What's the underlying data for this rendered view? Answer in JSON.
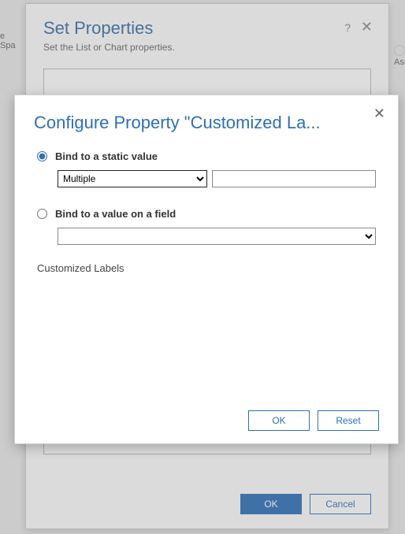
{
  "bg": {
    "left_label": "e Spa",
    "right_label": "Assi"
  },
  "outer": {
    "title": "Set Properties",
    "subtitle": "Set the List or Chart properties.",
    "help": "?",
    "close": "✕",
    "ok_label": "OK",
    "cancel_label": "Cancel"
  },
  "inner": {
    "title": "Configure Property \"Customized La...",
    "close": "✕",
    "radio_static_label": "Bind to a static value",
    "radio_field_label": "Bind to a value on a field",
    "static_select_value": "Multiple",
    "static_text_value": "",
    "field_select_value": "",
    "summary": "Customized Labels",
    "ok_label": "OK",
    "reset_label": "Reset"
  }
}
